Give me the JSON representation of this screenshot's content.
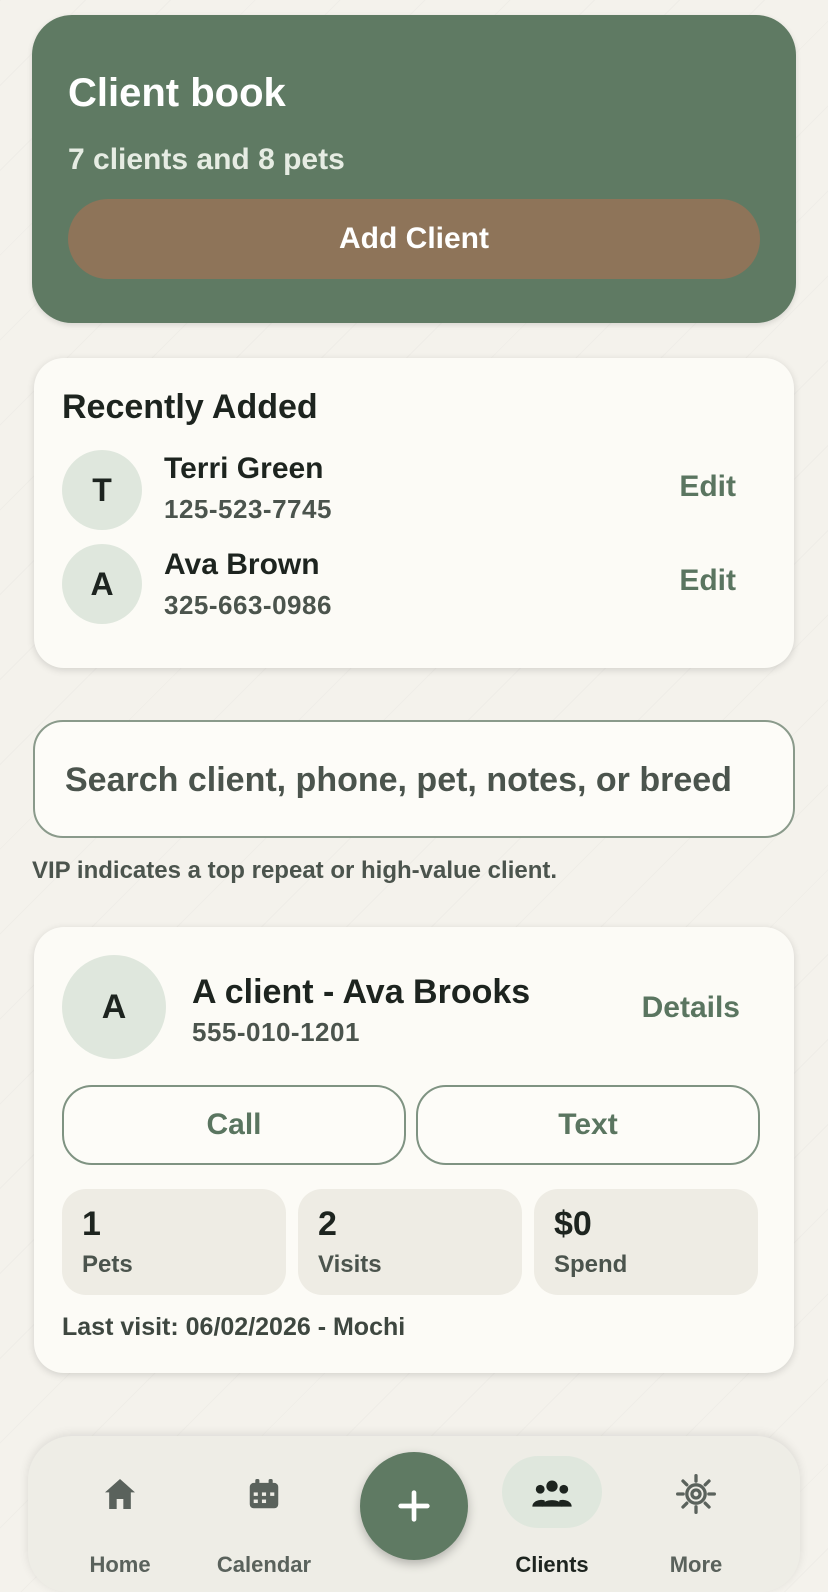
{
  "header": {
    "title": "Client book",
    "subtitle": "7 clients and 8 pets",
    "add_label": "Add Client"
  },
  "recent": {
    "title": "Recently Added",
    "items": [
      {
        "initial": "T",
        "name": "Terri Green",
        "phone": "125-523-7745",
        "action": "Edit"
      },
      {
        "initial": "A",
        "name": "Ava Brown",
        "phone": "325-663-0986",
        "action": "Edit"
      }
    ]
  },
  "search": {
    "placeholder": "Search client, phone, pet, notes, or breed",
    "value": ""
  },
  "vip_note": "VIP indicates a top repeat or high-value client.",
  "client_card": {
    "initial": "A",
    "name": "A client - Ava Brooks",
    "phone": "555-010-1201",
    "details_label": "Details",
    "call_label": "Call",
    "text_label": "Text",
    "stats": [
      {
        "value": "1",
        "label": "Pets"
      },
      {
        "value": "2",
        "label": "Visits"
      },
      {
        "value": "$0",
        "label": "Spend"
      }
    ],
    "last_visit": "Last visit: 06/02/2026 - Mochi"
  },
  "nav": {
    "items": [
      {
        "label": "Home",
        "icon": "home-icon"
      },
      {
        "label": "Calendar",
        "icon": "calendar-icon"
      },
      {
        "label": "Clients",
        "icon": "people-icon",
        "active": true
      },
      {
        "label": "More",
        "icon": "gear-icon"
      }
    ],
    "fab_icon": "plus-icon"
  },
  "colors": {
    "primary": "#5f7a63",
    "accent": "#8e7459",
    "background": "#f4f2ec",
    "card": "#fcfbf6"
  }
}
